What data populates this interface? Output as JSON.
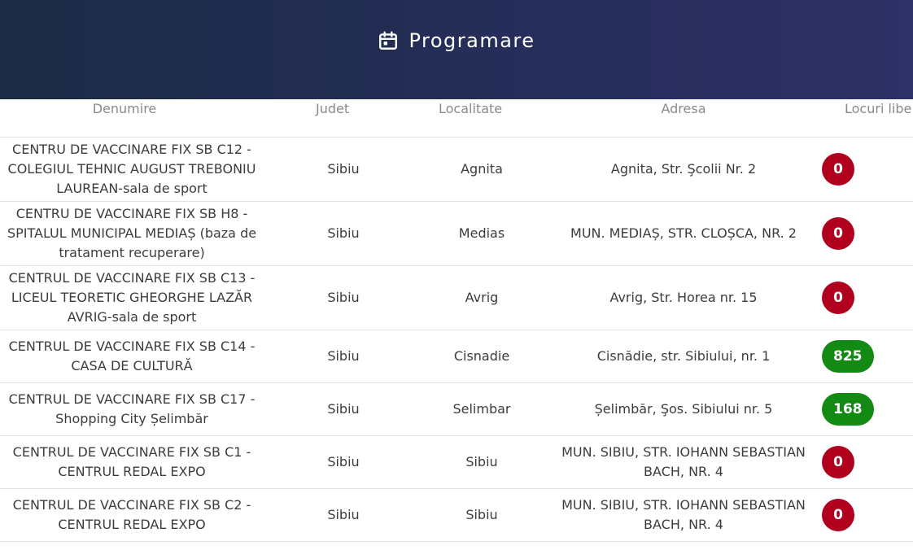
{
  "header": {
    "title": "Programare",
    "icon": "calendar-icon"
  },
  "table": {
    "columns": [
      "Denumire",
      "Judet",
      "Localitate",
      "Adresa",
      "Locuri libe"
    ],
    "rows": [
      {
        "denumire": "CENTRU DE VACCINARE FIX SB C12 - COLEGIUL TEHNIC AUGUST TREBONIU LAUREAN-sala de sport",
        "judet": "Sibiu",
        "localitate": "Agnita",
        "adresa": "Agnita, Str. Şcolii Nr. 2",
        "locuri": "0"
      },
      {
        "denumire": "CENTRU DE VACCINARE FIX SB H8 - SPITALUL MUNICIPAL MEDIAȘ (baza de tratament recuperare)",
        "judet": "Sibiu",
        "localitate": "Medias",
        "adresa": "MUN. MEDIAȘ, STR. CLOȘCA, NR. 2",
        "locuri": "0"
      },
      {
        "denumire": "CENTRUL DE VACCINARE FIX SB C13 - LICEUL TEORETIC GHEORGHE LAZĂR AVRIG-sala de sport",
        "judet": "Sibiu",
        "localitate": "Avrig",
        "adresa": "Avrig, Str. Horea nr. 15",
        "locuri": "0"
      },
      {
        "denumire": "CENTRUL DE VACCINARE FIX SB C14 - CASA DE CULTURĂ",
        "judet": "Sibiu",
        "localitate": "Cisnadie",
        "adresa": "Cisnădie, str. Sibiului, nr. 1",
        "locuri": "825"
      },
      {
        "denumire": "CENTRUL DE VACCINARE FIX SB C17 - Shopping City Șelimbăr",
        "judet": "Sibiu",
        "localitate": "Selimbar",
        "adresa": "Șelimbăr, Şos. Sibiului nr. 5",
        "locuri": "168"
      },
      {
        "denumire": "CENTRUL DE VACCINARE FIX SB C1 - CENTRUL REDAL EXPO",
        "judet": "Sibiu",
        "localitate": "Sibiu",
        "adresa": "MUN. SIBIU, STR. IOHANN SEBASTIAN BACH, NR. 4",
        "locuri": "0"
      },
      {
        "denumire": "CENTRUL DE VACCINARE FIX SB C2 - CENTRUL REDAL EXPO",
        "judet": "Sibiu",
        "localitate": "Sibiu",
        "adresa": "MUN. SIBIU, STR. IOHANN SEBASTIAN BACH, NR. 4",
        "locuri": "0"
      }
    ]
  },
  "colors": {
    "header_gradient_start": "#1b2b45",
    "header_gradient_end": "#2f3066",
    "badge_zero": "#b0001e",
    "badge_available": "#128a14"
  }
}
